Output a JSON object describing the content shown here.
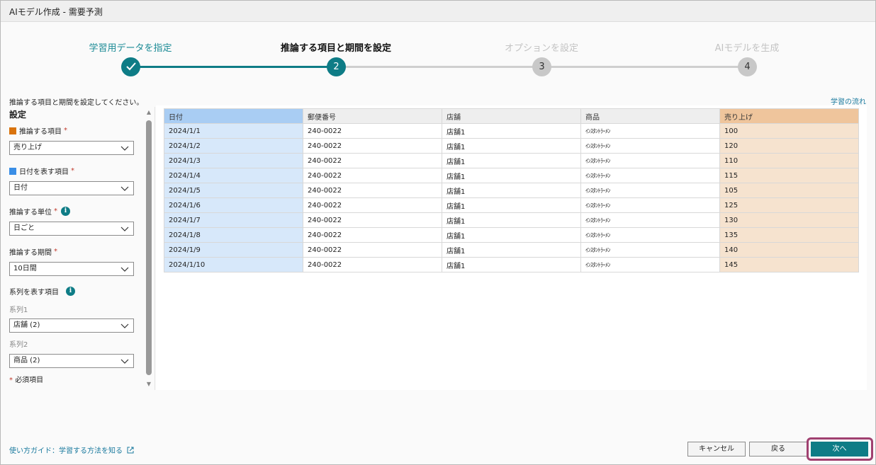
{
  "window": {
    "title": "AIモデル作成 - 需要予測"
  },
  "stepper": {
    "steps": [
      {
        "label": "学習用データを指定",
        "number": "",
        "state": "done"
      },
      {
        "label": "推論する項目と期間を設定",
        "number": "2",
        "state": "active"
      },
      {
        "label": "オプションを設定",
        "number": "3",
        "state": "pending"
      },
      {
        "label": "AIモデルを生成",
        "number": "4",
        "state": "pending"
      }
    ]
  },
  "instruction": "推論する項目と期間を設定してください。",
  "learn_flow_link": "学習の流れ",
  "settings": {
    "title": "設定",
    "target_label": "推論する項目",
    "target_value": "売り上げ",
    "date_label": "日付を表す項目",
    "date_value": "日付",
    "unit_label": "推論する単位",
    "unit_value": "日ごと",
    "period_label": "推論する期間",
    "period_value": "10日間",
    "series_label": "系列を表す項目",
    "series1_label": "系列1",
    "series1_value": "店舗 (2)",
    "series2_label": "系列2",
    "series2_value": "商品 (2)",
    "required_mark": "*",
    "required_note": "必須項目",
    "colors": {
      "target": "#d9730d",
      "date": "#3a8ee6"
    }
  },
  "table": {
    "headers": [
      "日付",
      "郵便番号",
      "店舗",
      "商品",
      "売り上げ"
    ],
    "rows": [
      [
        "2024/1/1",
        "240-0022",
        "店舗1",
        "ｲﾝｽﾀﾝﾄﾗｰﾒﾝ",
        "100"
      ],
      [
        "2024/1/2",
        "240-0022",
        "店舗1",
        "ｲﾝｽﾀﾝﾄﾗｰﾒﾝ",
        "120"
      ],
      [
        "2024/1/3",
        "240-0022",
        "店舗1",
        "ｲﾝｽﾀﾝﾄﾗｰﾒﾝ",
        "110"
      ],
      [
        "2024/1/4",
        "240-0022",
        "店舗1",
        "ｲﾝｽﾀﾝﾄﾗｰﾒﾝ",
        "115"
      ],
      [
        "2024/1/5",
        "240-0022",
        "店舗1",
        "ｲﾝｽﾀﾝﾄﾗｰﾒﾝ",
        "105"
      ],
      [
        "2024/1/6",
        "240-0022",
        "店舗1",
        "ｲﾝｽﾀﾝﾄﾗｰﾒﾝ",
        "125"
      ],
      [
        "2024/1/7",
        "240-0022",
        "店舗1",
        "ｲﾝｽﾀﾝﾄﾗｰﾒﾝ",
        "130"
      ],
      [
        "2024/1/8",
        "240-0022",
        "店舗1",
        "ｲﾝｽﾀﾝﾄﾗｰﾒﾝ",
        "135"
      ],
      [
        "2024/1/9",
        "240-0022",
        "店舗1",
        "ｲﾝｽﾀﾝﾄﾗｰﾒﾝ",
        "140"
      ],
      [
        "2024/1/10",
        "240-0022",
        "店舗1",
        "ｲﾝｽﾀﾝﾄﾗｰﾒﾝ",
        "145"
      ]
    ]
  },
  "footer": {
    "guide_link": "使い方ガイド：学習する方法を知る",
    "cancel": "キャンセル",
    "back": "戻る",
    "next": "次へ"
  }
}
